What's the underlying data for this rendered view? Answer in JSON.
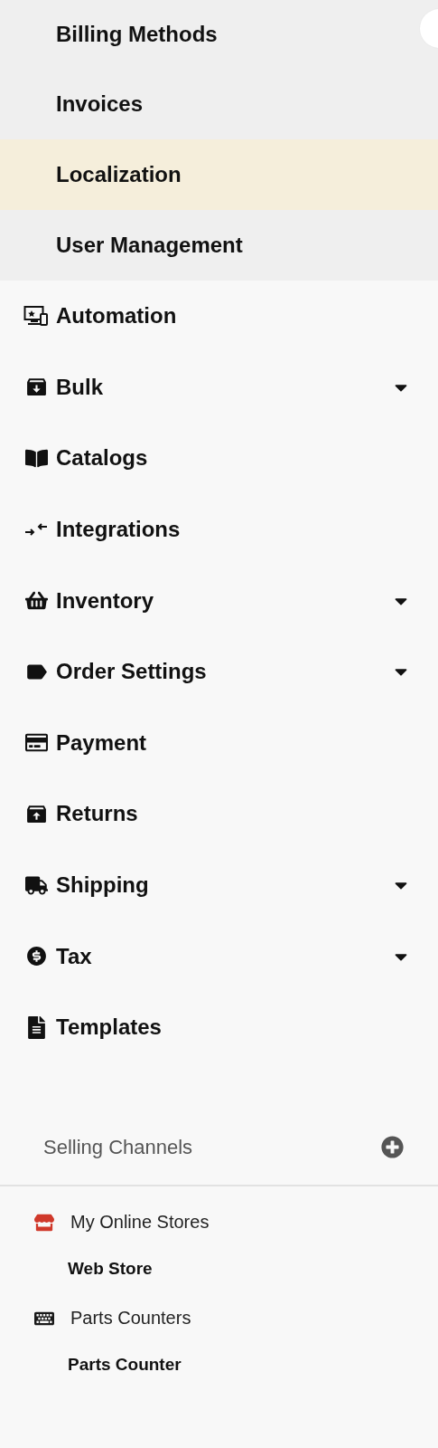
{
  "settings_submenu": [
    {
      "label": "Billing Methods",
      "selected": false
    },
    {
      "label": "Invoices",
      "selected": false
    },
    {
      "label": "Localization",
      "selected": true
    },
    {
      "label": "User Management",
      "selected": false
    }
  ],
  "menu": [
    {
      "label": "Automation",
      "submenu": false
    },
    {
      "label": "Bulk",
      "submenu": true
    },
    {
      "label": "Catalogs",
      "submenu": false
    },
    {
      "label": "Integrations",
      "submenu": false
    },
    {
      "label": "Inventory",
      "submenu": true
    },
    {
      "label": "Order Settings",
      "submenu": true
    },
    {
      "label": "Payment",
      "submenu": false
    },
    {
      "label": "Returns",
      "submenu": false
    },
    {
      "label": "Shipping",
      "submenu": true
    },
    {
      "label": "Tax",
      "submenu": true
    },
    {
      "label": "Templates",
      "submenu": false
    }
  ],
  "selling_channels": {
    "title": "Selling Channels",
    "groups": [
      {
        "label": "My Online Stores",
        "color": "#d0392b",
        "items": [
          "Web Store"
        ]
      },
      {
        "label": "Parts Counters",
        "color": "#1a1a1a",
        "items": [
          "Parts Counter"
        ]
      }
    ]
  }
}
